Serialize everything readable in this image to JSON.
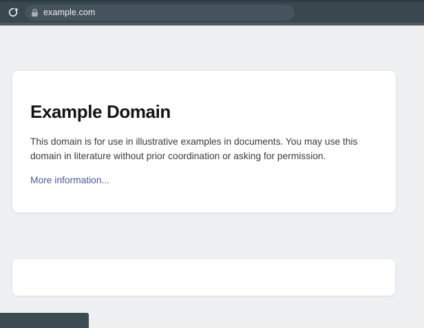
{
  "browser": {
    "url": "example.com",
    "toolbar": {
      "refresh_icon": "circular-arrow-clockwise",
      "lock_icon": "padlock"
    }
  },
  "page": {
    "heading": "Example Domain",
    "body_lines": [
      "This domain is for use in illustrative examples in documents. You may use this",
      "domain in literature without prior coordination or asking for permission."
    ],
    "link_label": "More information..."
  },
  "colors": {
    "toolbar_bg": "#3A474E",
    "toolbar_top_edge": "#2F3B42",
    "toolbar_bottom_edge": "#4D5A63",
    "urlbar_bg": "#46525C",
    "url_text": "#EDF0F2",
    "lock_icon": "#A9B2B8",
    "refresh_icon": "#ECEFF1",
    "page_bg": "#EFF0F2",
    "card_bg": "#FFFFFF",
    "heading_text": "#141414",
    "body_text": "#3B3B3B",
    "link": "#4A559B",
    "status_bubble_bg": "#3C4A52"
  }
}
